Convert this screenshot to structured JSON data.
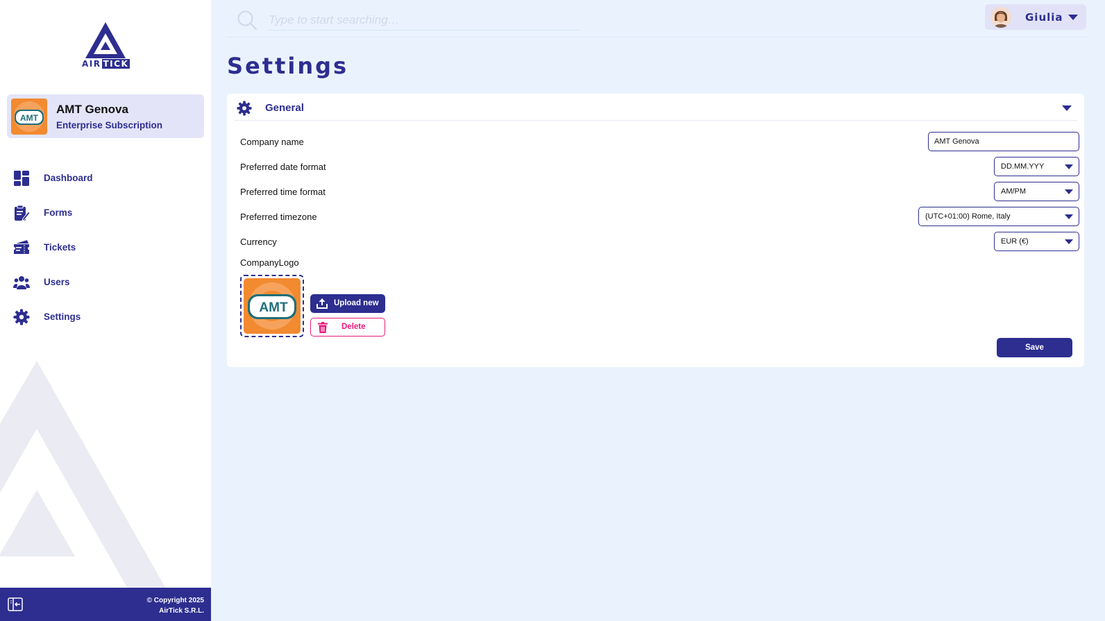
{
  "brand": {
    "logo_word_1": "AIR",
    "logo_word_2": "TICK"
  },
  "org": {
    "name": "AMT Genova",
    "plan": "Enterprise Subscription",
    "logo_text": "AMT"
  },
  "nav": {
    "items": [
      {
        "label": "Dashboard",
        "icon": "dashboard-icon"
      },
      {
        "label": "Forms",
        "icon": "forms-icon"
      },
      {
        "label": "Tickets",
        "icon": "tickets-icon"
      },
      {
        "label": "Users",
        "icon": "users-icon"
      },
      {
        "label": "Settings",
        "icon": "gear-icon"
      }
    ]
  },
  "footer": {
    "line1": "© Copyright 2025",
    "line2": "AirTick S.R.L."
  },
  "search": {
    "placeholder": "Type to start searching…"
  },
  "user": {
    "name": "Giulia"
  },
  "page": {
    "title": "Settings"
  },
  "general": {
    "title": "General",
    "company_name": {
      "label": "Company name",
      "value": "AMT Genova"
    },
    "date_format": {
      "label": "Preferred date format",
      "value": "DD.MM.YYY"
    },
    "time_format": {
      "label": "Preferred time format",
      "value": "AM/PM"
    },
    "timezone": {
      "label": "Preferred timezone",
      "value": "(UTC+01:00) Rome, Italy"
    },
    "currency": {
      "label": "Currency",
      "value": "EUR (€)"
    },
    "logo": {
      "label": "CompanyLogo",
      "logo_text": "AMT"
    },
    "upload_label": "Upload new",
    "delete_label": "Delete",
    "save_label": "Save"
  },
  "colors": {
    "primary": "#2d2e8f",
    "accent_orange": "#f28a30",
    "danger": "#e8197a",
    "background": "#eaf3fd"
  }
}
